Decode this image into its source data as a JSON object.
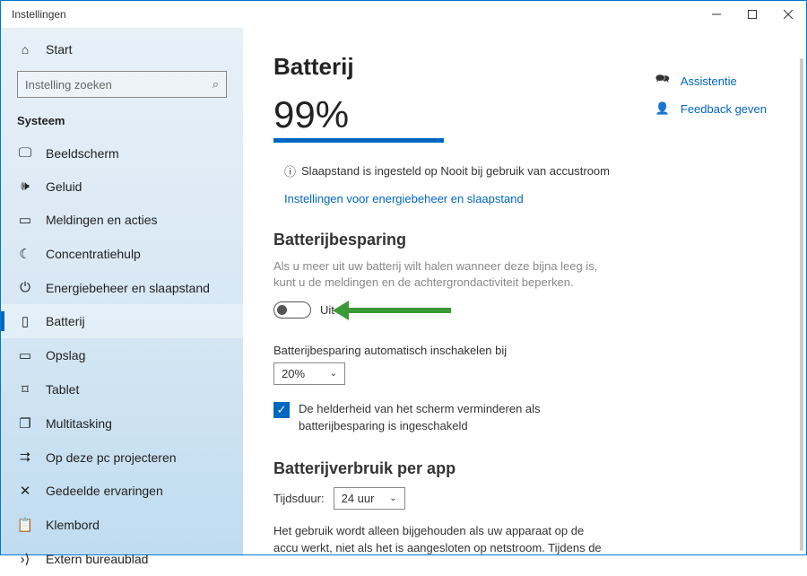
{
  "window": {
    "title": "Instellingen"
  },
  "sidebar": {
    "start": "Start",
    "search_placeholder": "Instelling zoeken",
    "category": "Systeem",
    "items": [
      {
        "label": "Beeldscherm",
        "icon": "display-icon"
      },
      {
        "label": "Geluid",
        "icon": "sound-icon"
      },
      {
        "label": "Meldingen en acties",
        "icon": "notifications-icon"
      },
      {
        "label": "Concentratiehulp",
        "icon": "focus-icon"
      },
      {
        "label": "Energiebeheer en slaapstand",
        "icon": "power-icon"
      },
      {
        "label": "Batterij",
        "icon": "battery-icon",
        "active": true
      },
      {
        "label": "Opslag",
        "icon": "storage-icon"
      },
      {
        "label": "Tablet",
        "icon": "tablet-icon"
      },
      {
        "label": "Multitasking",
        "icon": "multitasking-icon"
      },
      {
        "label": "Op deze pc projecteren",
        "icon": "project-icon"
      },
      {
        "label": "Gedeelde ervaringen",
        "icon": "shared-icon"
      },
      {
        "label": "Klembord",
        "icon": "clipboard-icon"
      },
      {
        "label": "Extern bureaublad",
        "icon": "remote-icon"
      }
    ]
  },
  "main": {
    "title": "Batterij",
    "percent": "99%",
    "sleep_info": "Slaapstand is ingesteld op Nooit bij gebruik van accustroom",
    "power_link": "Instellingen voor energiebeheer en slaapstand",
    "saver": {
      "heading": "Batterijbesparing",
      "desc": "Als u meer uit uw batterij wilt halen wanneer deze bijna leeg is, kunt u de meldingen en de achtergrondactiviteit beperken.",
      "toggle_state": "Uit",
      "auto_label": "Batterijbesparing automatisch inschakelen bij",
      "auto_value": "20%",
      "brightness_check": "De helderheid van het scherm verminderen als batterijbesparing is ingeschakeld"
    },
    "usage": {
      "heading": "Batterijverbruik per app",
      "time_label": "Tijdsduur:",
      "time_value": "24 uur",
      "note": "Het gebruik wordt alleen bijgehouden als uw apparaat op de accu werkt, niet als het is aangesloten op netstroom. Tijdens de geselecteerde periode is de accu niet gebruikt door apps."
    }
  },
  "rail": {
    "help": "Assistentie",
    "feedback": "Feedback geven"
  }
}
